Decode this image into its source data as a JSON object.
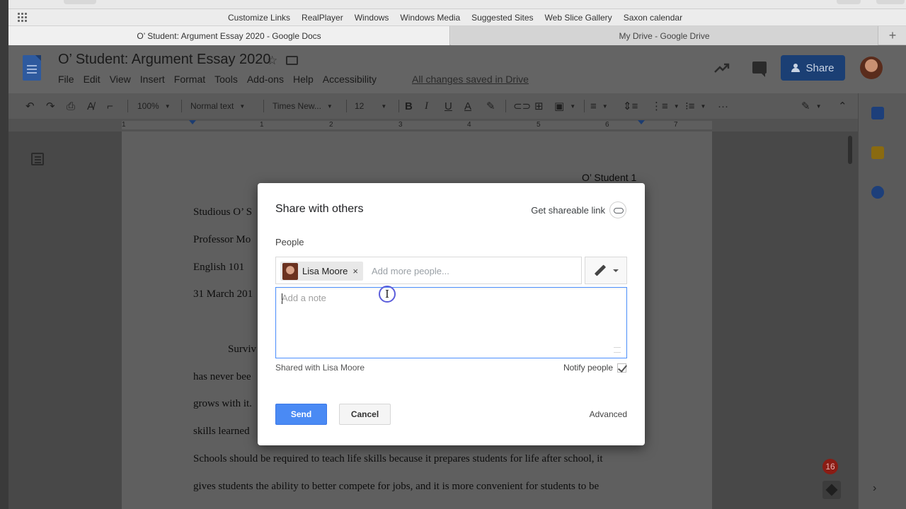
{
  "bookmarks": [
    "Customize Links",
    "RealPlayer",
    "Windows",
    "Windows Media",
    "Suggested Sites",
    "Web Slice Gallery",
    "Saxon calendar"
  ],
  "tabs": [
    {
      "label": "O’ Student: Argument Essay 2020 - Google Docs"
    },
    {
      "label": "My Drive - Google Drive"
    }
  ],
  "tab_plus": "+",
  "doc": {
    "title": "O’ Student: Argument Essay 2020",
    "menu": [
      "File",
      "Edit",
      "View",
      "Insert",
      "Format",
      "Tools",
      "Add-ons",
      "Help",
      "Accessibility"
    ],
    "save_status": "All changes saved in Drive",
    "share_label": "Share"
  },
  "toolbar": {
    "zoom": "100%",
    "style": "Normal text",
    "font": "Times New...",
    "size": "12",
    "more": "···"
  },
  "ruler_numbers": [
    "1",
    "1",
    "2",
    "3",
    "4",
    "5",
    "6",
    "7"
  ],
  "page": {
    "header": "O’ Student 1",
    "lines": [
      "Studious O’ S",
      "Professor Mo",
      "English 101",
      "31 March 201"
    ],
    "body_lines": [
      "Surviv",
      "has never bee",
      "grows with it.",
      "skills learned",
      "Schools should be required to teach life skills because it prepares students for life after school, it",
      "gives students the ability to better compete for jobs, and it is more convenient for students to be"
    ]
  },
  "notifications_count": "16",
  "dialog": {
    "title": "Share with others",
    "get_link": "Get shareable link",
    "people_label": "People",
    "chip_name": "Lisa Moore",
    "chip_remove": "×",
    "add_people_placeholder": "Add more people...",
    "note_placeholder": "Add a note",
    "shared_with": "Shared with Lisa Moore",
    "notify_label": "Notify people",
    "notify_checked": true,
    "send": "Send",
    "cancel": "Cancel",
    "advanced": "Advanced"
  },
  "colors": {
    "share_button": "#1a73e8",
    "send_button": "#4a8af4",
    "note_focus_border": "#4d90fe"
  }
}
